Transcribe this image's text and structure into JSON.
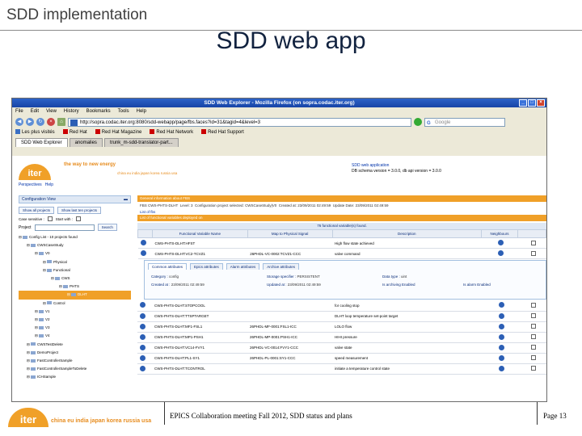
{
  "slide": {
    "header": "SDD implementation",
    "title": "SDD web app",
    "footer_text": "EPICS Collaboration meeting  Fall 2012, SDD status and plans",
    "page_label": "Page 13",
    "footer_logo": "iter",
    "footer_countries": "china eu india japan korea russia usa"
  },
  "browser": {
    "window_title": "SDD Web Explorer - Mozilla Firefox (on sopra.codac.iter.org)",
    "menu": [
      "File",
      "Edit",
      "View",
      "History",
      "Bookmarks",
      "Tools",
      "Help"
    ],
    "url": "http://sopra.codac.iter.org:8080/sdd-webapp/page/fbs.faces?id=31&tagid=4&level=3",
    "search_placeholder": "Google",
    "bookmarks": [
      "Les plus visités",
      "Red Hat",
      "Red Hat Magazine",
      "Red Hat Network",
      "Red Hat Support"
    ],
    "tabs": [
      "SDD Web Explorer",
      "anomalies",
      "trunk_m-sdd-translator-part..."
    ]
  },
  "app": {
    "logo": "iter",
    "tagline": "the way to new energy",
    "countries": "china eu india japan korea russia usa",
    "info_link": "SDD web application",
    "info_version": "DB schema version = 3.0.0, db api version = 3.0.0",
    "topnav": [
      "Perspectives",
      "Help"
    ],
    "config_view": "Configuration View",
    "btn_all_projects": "Show all projects",
    "btn_last_ten": "Show last ten projects",
    "case_sensitive": "Case sensitive :",
    "start_with": "Start with :",
    "project_label": "Project",
    "search_btn": "Search",
    "tree": [
      {
        "label": "Config List - 10 projects found",
        "indent": 0
      },
      {
        "label": "CWSCaseStudy",
        "indent": 1
      },
      {
        "label": "V0",
        "indent": 2
      },
      {
        "label": "Physical",
        "indent": 3
      },
      {
        "label": "Functional",
        "indent": 3
      },
      {
        "label": "CWS",
        "indent": 4
      },
      {
        "label": "PHTS",
        "indent": 5
      },
      {
        "label": "DLHT",
        "indent": 6,
        "selected": true
      },
      {
        "label": "Control",
        "indent": 3
      },
      {
        "label": "V1",
        "indent": 2
      },
      {
        "label": "V2",
        "indent": 2
      },
      {
        "label": "V3",
        "indent": 2
      },
      {
        "label": "V4",
        "indent": 2
      },
      {
        "label": "CWSTestDelete",
        "indent": 1
      },
      {
        "label": "DemoProject",
        "indent": 1
      },
      {
        "label": "FastControllerSample",
        "indent": 1
      },
      {
        "label": "FastControllerSampleToDelete",
        "indent": 1
      },
      {
        "label": "ICHSample",
        "indent": 1
      }
    ],
    "general_info_title": "General information about FBS",
    "fbs_row": {
      "fbs_label": "FBS",
      "fbs_value": "CWS-PHTS-DLHT",
      "level": "Level: 3",
      "config_label": "Configuration project selected:",
      "config_value": "CWSCaseStudy|V0",
      "created_label": "Created at:",
      "created_value": "23/09/2011 02:49:59",
      "update_label": "Update Date:",
      "update_value": "23/09/2011 02:49:59"
    },
    "list_of_fbs": "List of fbs",
    "list_title": "List of functional variables deployed on",
    "found_text": "76 functional variable(s) found.",
    "columns": [
      "",
      "Functional Variable Name",
      "Map to Physical Signal",
      "Description",
      "Neighbours",
      ""
    ],
    "rows_top": [
      {
        "name": "CWS-PHTS-DLHT:HFST",
        "signal": "",
        "desc": "High flow state achieved"
      },
      {
        "name": "CWS-PHTS-DLHT:VC2-TCVZ1",
        "signal": "26PHDL-VC-0002:TCVZ1-CCC",
        "desc": "valve command"
      }
    ],
    "detail_tabs": [
      "Common attributes",
      "Epics attributes",
      "Alarm attributes",
      "Archive attributes"
    ],
    "detail": {
      "category_label": "Category :",
      "category_value": "config",
      "storage_label": "Storage specifier :",
      "storage_value": "PERSISTENT",
      "datatype_label": "Data type :",
      "datatype_value": "uint",
      "created_label": "Created at :",
      "created_value": "23/09/2011 02:49:59",
      "updated_label": "Updated at :",
      "updated_value": "23/09/2011 02:49:59",
      "archiving": "Is archiving Enabled",
      "alarm": "Is alarm Enabled"
    },
    "rows_bottom": [
      {
        "name": "CWS-PHTS-DLHT:STOPCOOL",
        "signal": "",
        "desc": "for cooling stop"
      },
      {
        "name": "CWS-PHTS-DLHT:TTSPTARGET",
        "signal": "",
        "desc": "DLHT loop temperature set-point target"
      },
      {
        "name": "CWS-PHTS-DLHT:MF1-FSL1",
        "signal": "26PHDL-MF-0001:FSL1-ICC",
        "desc": "LOLO flow"
      },
      {
        "name": "CWS-PHTS-DLHT:MP1-PSH1",
        "signal": "26PHDL-MP-0001:PSH1-ICC",
        "desc": "HIHI pressure"
      },
      {
        "name": "CWS-PHTS-DLHT:VC14-FVY1",
        "signal": "26PHDL-VC-0014:FVY1-CCC",
        "desc": "valve state"
      },
      {
        "name": "CWS-PHTS-DLHT:PL1-SY1",
        "signal": "26PHDL-PL-0001:SY1-CCC",
        "desc": "speed measurement"
      },
      {
        "name": "CWS-PHTS-DLHT:TCONTROL",
        "signal": "",
        "desc": "initiate a temperature control state"
      }
    ]
  }
}
